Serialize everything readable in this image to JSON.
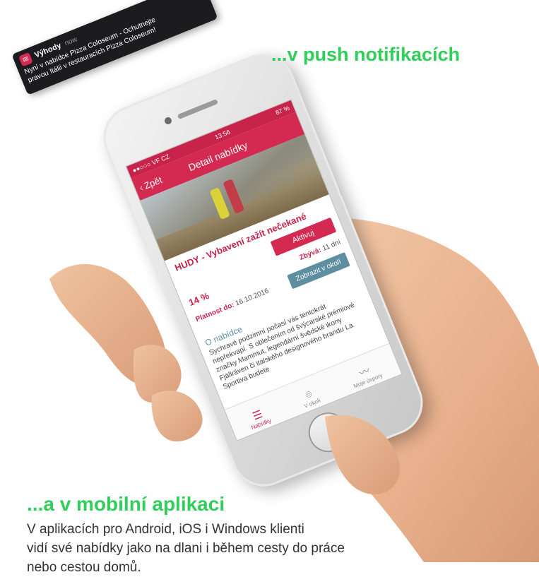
{
  "headings": {
    "push": "...v push notifikacích",
    "app": "...a v mobilní aplikaci"
  },
  "description": {
    "line1": "V aplikacích pro Android, iOS i Windows klienti",
    "line2": "vidí své nabídky jako na dlani i během cesty do práce",
    "line3": "nebo cestou domů."
  },
  "notification": {
    "app_name": "Výhody",
    "time": "now",
    "message_line1": "Nyní v nabídce Pizza Coloseum - Ochutnejte",
    "message_line2": "pravou Itálii v restauracích Pizza Coloseum!"
  },
  "status_bar": {
    "carrier": "●●○○○ VF CZ",
    "time": "13:56",
    "battery": "87 %"
  },
  "nav": {
    "back_label": "Zpět",
    "title": "Detail nabídky"
  },
  "offer": {
    "title": "HUDY - Vybavení zažít nečekané",
    "activate_label": "Aktivuj",
    "discount": "14 %",
    "remaining_label": "Zbývá:",
    "remaining_value": "11 dní",
    "valid_label": "Platnost do:",
    "valid_value": "16.10.2016",
    "show_near_label": "Zobrazit v okolí",
    "about_heading": "O nabídce",
    "about_text": "Sychravé podzimní počasí vás tentokrát nepřekvapí. S oblečením od švýcarské prémiové značky Mammut, legendární švédské ikony Fjällräven či italského designového brandu La Sportiva budete"
  },
  "tabs": [
    {
      "label": "Nabídky",
      "icon": "list-icon"
    },
    {
      "label": "V okolí",
      "icon": "location-pin-icon"
    },
    {
      "label": "Moje úspory",
      "icon": "chart-line-icon"
    }
  ],
  "colors": {
    "accent_green": "#2fcf5a",
    "brand_red": "#d42a52",
    "button_blue": "#5e8fa0"
  }
}
